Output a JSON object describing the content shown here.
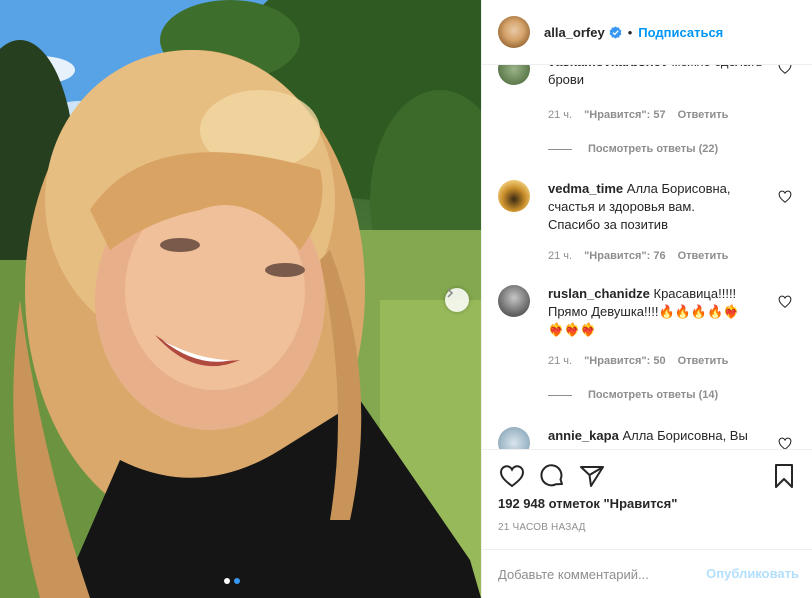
{
  "colors": {
    "accent": "#0095f6",
    "verified": "#3897f0",
    "muted": "#8e8e8e",
    "text": "#262626",
    "heart_emoji": "#e0234e",
    "fire_emoji": "#ff8a00",
    "publish_disabled": "#b2dffc"
  },
  "header": {
    "username": "alla_orfey",
    "dot": "•",
    "follow_label": "Подписаться"
  },
  "comments": [
    {
      "username": "vaskamovkarbshev",
      "text": "можно сделать брови",
      "text_line2": "",
      "text_line3": "",
      "time": "21 ч.",
      "likes": "\"Нравится\": 57",
      "reply": "Ответить",
      "view_replies": "Посмотреть ответы (22)"
    },
    {
      "username": "vedma_time",
      "text": "Алла Борисовна,",
      "text_line2": "счастья и здоровья вам.",
      "text_line3": "Спасибо за позитив",
      "time": "21 ч.",
      "likes": "\"Нравится\": 76",
      "reply": "Ответить",
      "view_replies": ""
    },
    {
      "username": "ruslan_chanidze",
      "text": "Красавица!!!!!",
      "text_line2": "Прямо Девушка!!!!🔥🔥🔥🔥❤️‍🔥",
      "text_line3": "❤️‍🔥❤️‍🔥❤️‍🔥",
      "time": "21 ч.",
      "likes": "\"Нравится\": 50",
      "reply": "Ответить",
      "view_replies": "Посмотреть ответы (14)"
    },
    {
      "username": "annie_kapa",
      "text": "Алла Борисовна, Вы",
      "text_line2": "",
      "text_line3": "",
      "time": "",
      "likes": "",
      "reply": "",
      "view_replies": ""
    }
  ],
  "post": {
    "likes_text": "192 948 отметок \"Нравится\"",
    "date_text": "21 часов назад"
  },
  "add_comment": {
    "placeholder": "Добавьте комментарий...",
    "publish_label": "Опубликовать"
  },
  "icons": {
    "verified": "verified-badge-icon",
    "like": "heart-icon",
    "comment": "comment-bubble-icon",
    "share": "paper-plane-icon",
    "save": "bookmark-icon",
    "next": "chevron-right-icon"
  },
  "carousel": {
    "slide_count": 2,
    "active_slide": 2
  }
}
